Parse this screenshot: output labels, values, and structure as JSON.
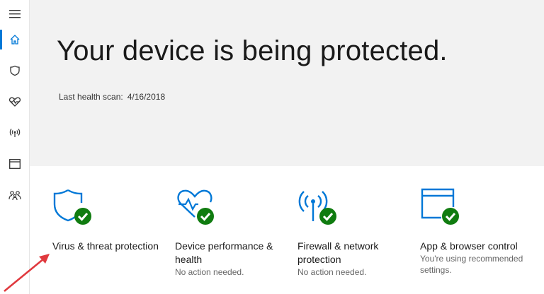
{
  "sidebar": {
    "items": [
      {
        "name": "hamburger-menu-icon"
      },
      {
        "name": "home-icon"
      },
      {
        "name": "shield-icon"
      },
      {
        "name": "heart-rate-icon"
      },
      {
        "name": "wireless-signal-icon"
      },
      {
        "name": "browser-window-icon"
      },
      {
        "name": "family-icon"
      }
    ],
    "active_index": 1
  },
  "hero": {
    "title": "Your device is being protected.",
    "scan_label": "Last health scan:",
    "scan_date": "4/16/2018"
  },
  "cards": [
    {
      "title": "Virus & threat protection",
      "status": "",
      "icon": "shield-check-icon"
    },
    {
      "title": "Device performance & health",
      "status": "No action needed.",
      "icon": "heart-check-icon"
    },
    {
      "title": "Firewall & network protection",
      "status": "No action needed.",
      "icon": "antenna-check-icon"
    },
    {
      "title": "App & browser control",
      "status": "You're using recommended settings.",
      "icon": "browser-check-icon"
    }
  ],
  "colors": {
    "accent": "#0078d7",
    "ok": "#107c10",
    "arrow": "#e0393e"
  }
}
